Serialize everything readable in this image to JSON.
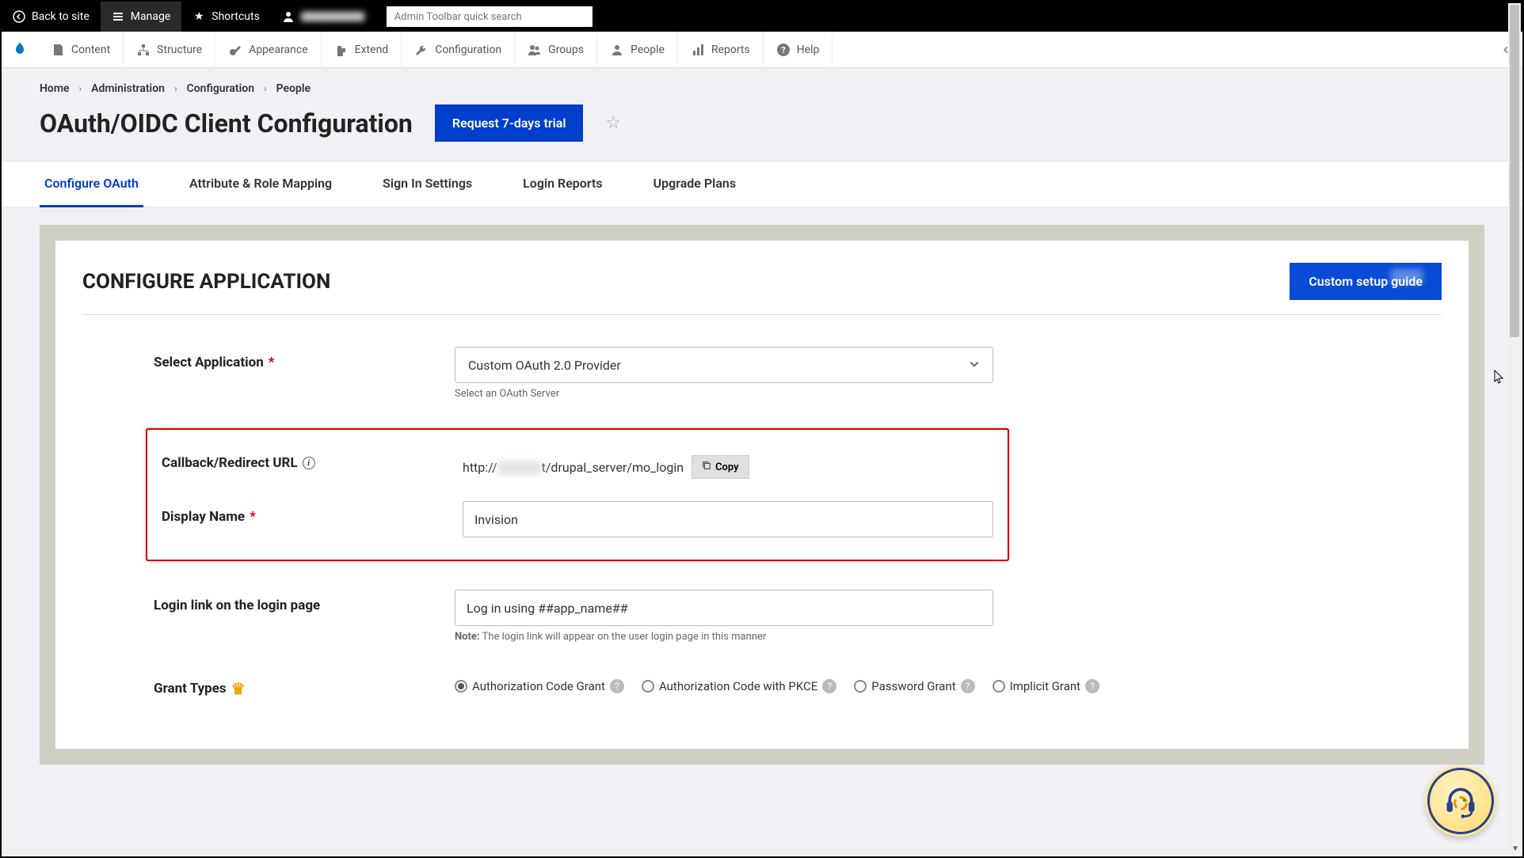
{
  "top_toolbar": {
    "back": "Back to site",
    "manage": "Manage",
    "shortcuts": "Shortcuts",
    "search_placeholder": "Admin Toolbar quick search"
  },
  "admin_menu": {
    "items": [
      {
        "label": "Content"
      },
      {
        "label": "Structure"
      },
      {
        "label": "Appearance"
      },
      {
        "label": "Extend"
      },
      {
        "label": "Configuration"
      },
      {
        "label": "Groups"
      },
      {
        "label": "People"
      },
      {
        "label": "Reports"
      },
      {
        "label": "Help"
      }
    ]
  },
  "breadcrumb": {
    "items": [
      "Home",
      "Administration",
      "Configuration",
      "People"
    ]
  },
  "page_title": "OAuth/OIDC Client Configuration",
  "trial_button": "Request 7-days trial",
  "tabs": [
    {
      "label": "Configure OAuth",
      "active": true
    },
    {
      "label": "Attribute & Role Mapping"
    },
    {
      "label": "Sign In Settings"
    },
    {
      "label": "Login Reports"
    },
    {
      "label": "Upgrade Plans"
    }
  ],
  "panel": {
    "title": "CONFIGURE APPLICATION",
    "custom_guide_btn": "Custom setup guide"
  },
  "form": {
    "select_app": {
      "label": "Select Application",
      "value": "Custom OAuth 2.0 Provider",
      "help": "Select an OAuth Server"
    },
    "callback": {
      "label": "Callback/Redirect URL",
      "prefix": "http://",
      "suffix": "t/drupal_server/mo_login",
      "copy_label": "Copy"
    },
    "display_name": {
      "label": "Display Name",
      "value": "Invision"
    },
    "login_link": {
      "label": "Login link on the login page",
      "value": "Log in using ##app_name##",
      "note_prefix": "Note:",
      "note": "The login link will appear on the user login page in this manner"
    },
    "grant_types": {
      "label": "Grant Types",
      "options": [
        {
          "label": "Authorization Code Grant",
          "checked": true
        },
        {
          "label": "Authorization Code with PKCE",
          "checked": false
        },
        {
          "label": "Password Grant",
          "checked": false
        },
        {
          "label": "Implicit Grant",
          "checked": false
        }
      ]
    }
  }
}
